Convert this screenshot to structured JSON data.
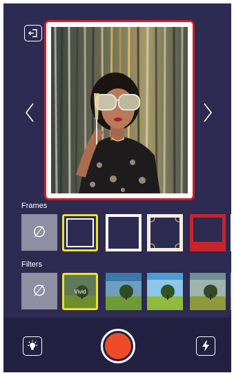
{
  "sections": {
    "frames_label": "Frames",
    "filters_label": "Filters"
  },
  "none_option": {
    "glyph": "∅"
  },
  "frames": [
    {
      "style": "none"
    },
    {
      "style": "plain-white",
      "selected": true
    },
    {
      "style": "white-lace"
    },
    {
      "style": "ornate-gold"
    },
    {
      "style": "red-polaroid"
    },
    {
      "style": "white-partial"
    }
  ],
  "filters": [
    {
      "style": "none"
    },
    {
      "label": "Vivid",
      "selected": true
    },
    {
      "label": ""
    },
    {
      "label": ""
    },
    {
      "label": ""
    },
    {
      "label": ""
    }
  ],
  "colors": {
    "background": "#2d2b52",
    "bottom_bar": "#232142",
    "selection": "#ece22d",
    "frame_border": "#cf1f2a",
    "shutter": "#ee4b27"
  },
  "icons": {
    "exit": "exit-icon",
    "prev": "chevron-left-icon",
    "next": "chevron-right-icon",
    "tips": "lightbulb-icon",
    "flash": "flash-icon"
  }
}
